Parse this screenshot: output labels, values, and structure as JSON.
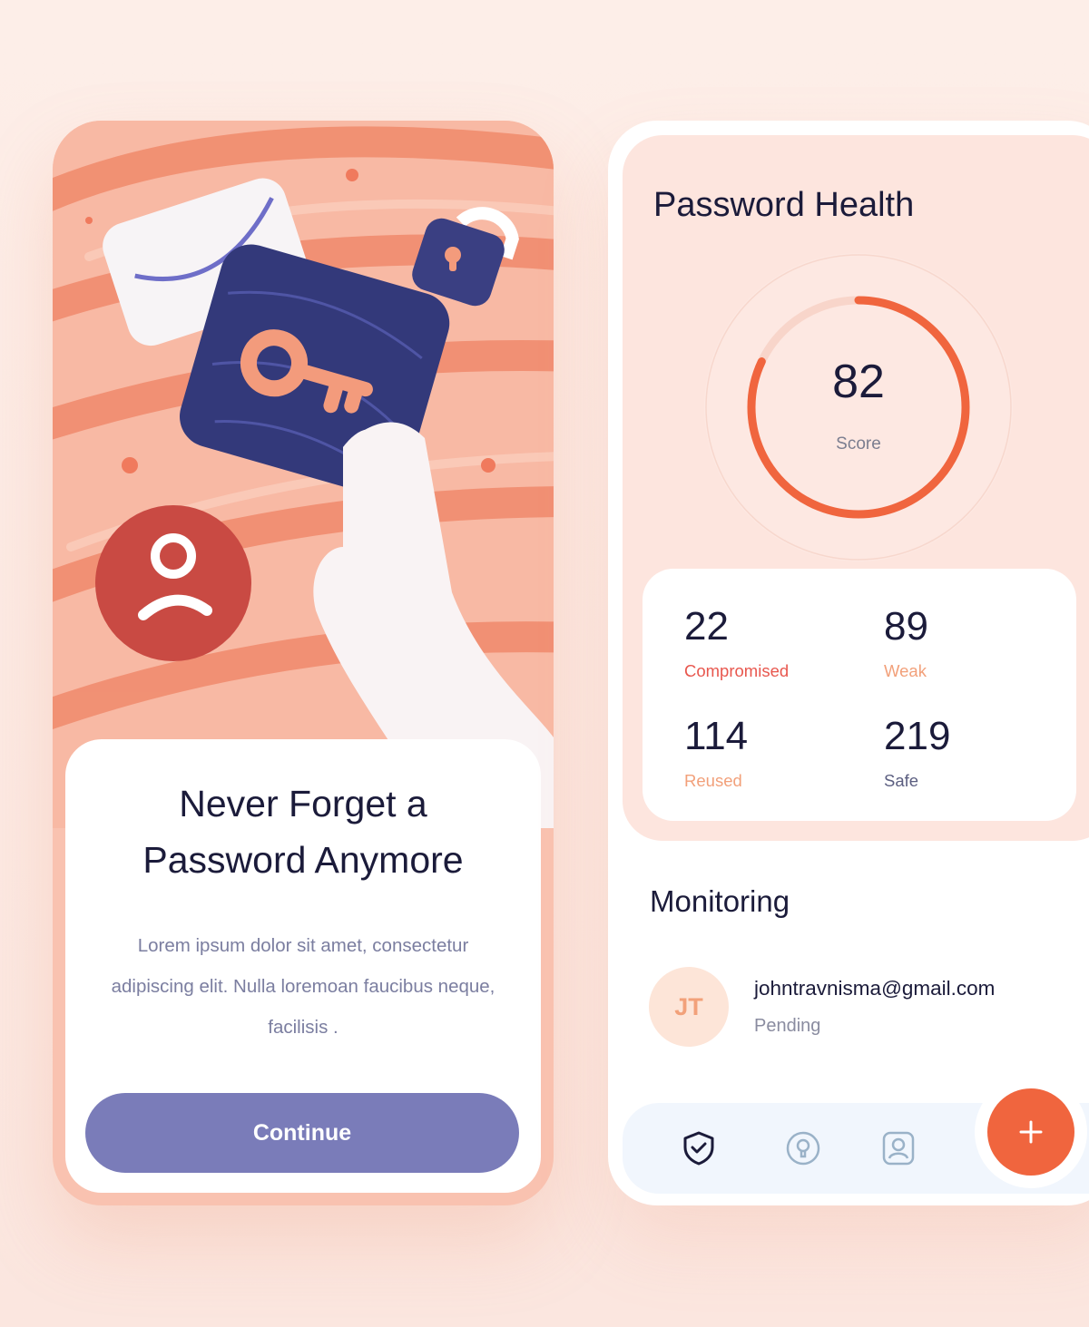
{
  "onboarding": {
    "headline": "Never Forget a\nPassword Anymore",
    "body": "Lorem ipsum dolor sit amet, consectetur adipiscing elit. Nulla loremoan faucibus neque, facilisis .",
    "continue_label": "Continue"
  },
  "health": {
    "title": "Password Health",
    "score": "82",
    "score_value": 82,
    "score_label": "Score",
    "stats": [
      {
        "value": "22",
        "label": "Compromised",
        "color": "#e8574e"
      },
      {
        "value": "89",
        "label": "Weak",
        "color": "#f2a07a"
      },
      {
        "value": "114",
        "label": "Reused",
        "color": "#f2a07a"
      },
      {
        "value": "219",
        "label": "Safe",
        "color": "#5b5e80"
      }
    ]
  },
  "monitoring": {
    "title": "Monitoring",
    "avatar_initials": "JT",
    "email": "johntravnisma@gmail.com",
    "status": "Pending"
  },
  "nav": {
    "items": [
      "shield-check-icon",
      "lightbulb-icon",
      "user-profile-icon"
    ],
    "fab_icon": "plus-icon"
  },
  "colors": {
    "accent": "#f0653e",
    "primary_button": "#7a7cb9",
    "text_dark": "#1b1b3a"
  }
}
